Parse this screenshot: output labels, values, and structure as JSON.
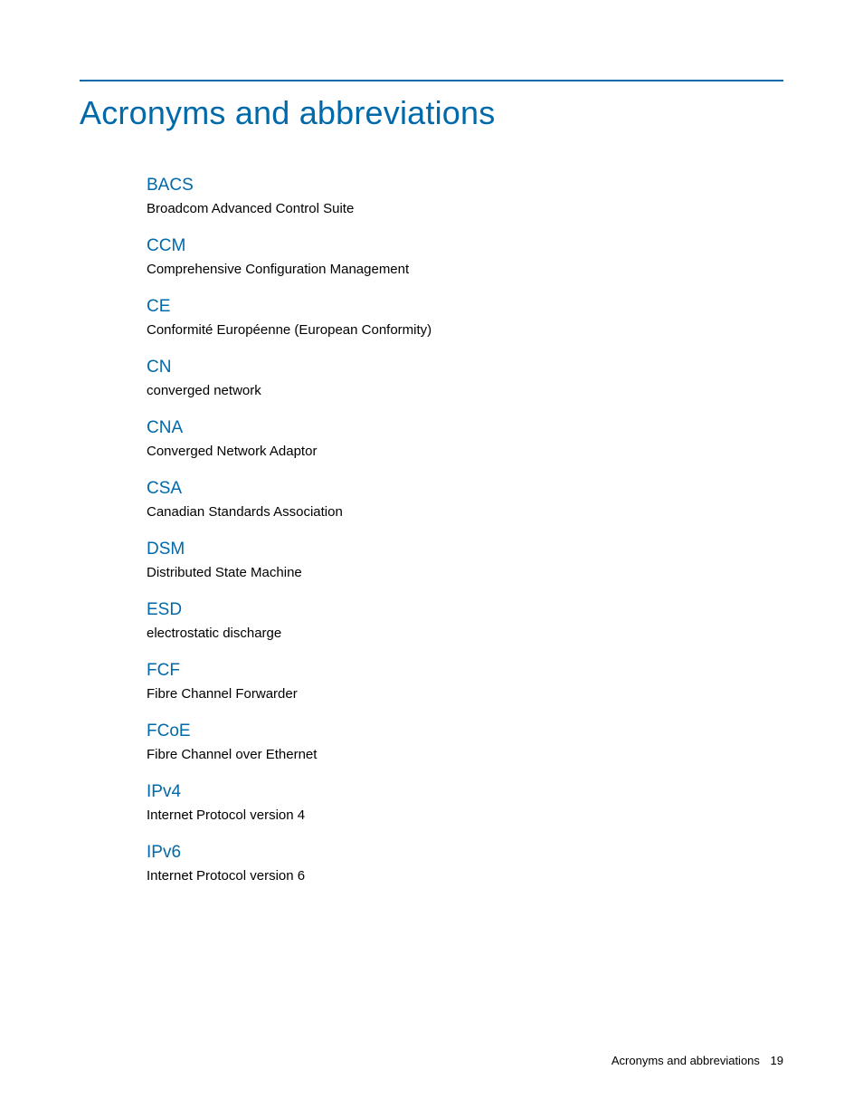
{
  "title": "Acronyms and abbreviations",
  "entries": [
    {
      "term": "BACS",
      "definition": "Broadcom Advanced Control Suite"
    },
    {
      "term": "CCM",
      "definition": "Comprehensive Configuration Management"
    },
    {
      "term": "CE",
      "definition": "Conformité Européenne (European Conformity)"
    },
    {
      "term": "CN",
      "definition": "converged network"
    },
    {
      "term": "CNA",
      "definition": "Converged Network Adaptor"
    },
    {
      "term": "CSA",
      "definition": "Canadian Standards Association"
    },
    {
      "term": "DSM",
      "definition": "Distributed State Machine"
    },
    {
      "term": "ESD",
      "definition": "electrostatic discharge"
    },
    {
      "term": "FCF",
      "definition": "Fibre Channel Forwarder"
    },
    {
      "term": "FCoE",
      "definition": "Fibre Channel over Ethernet"
    },
    {
      "term": "IPv4",
      "definition": "Internet Protocol version 4"
    },
    {
      "term": "IPv6",
      "definition": "Internet Protocol version 6"
    }
  ],
  "footer": {
    "section": "Acronyms and abbreviations",
    "page": "19"
  }
}
